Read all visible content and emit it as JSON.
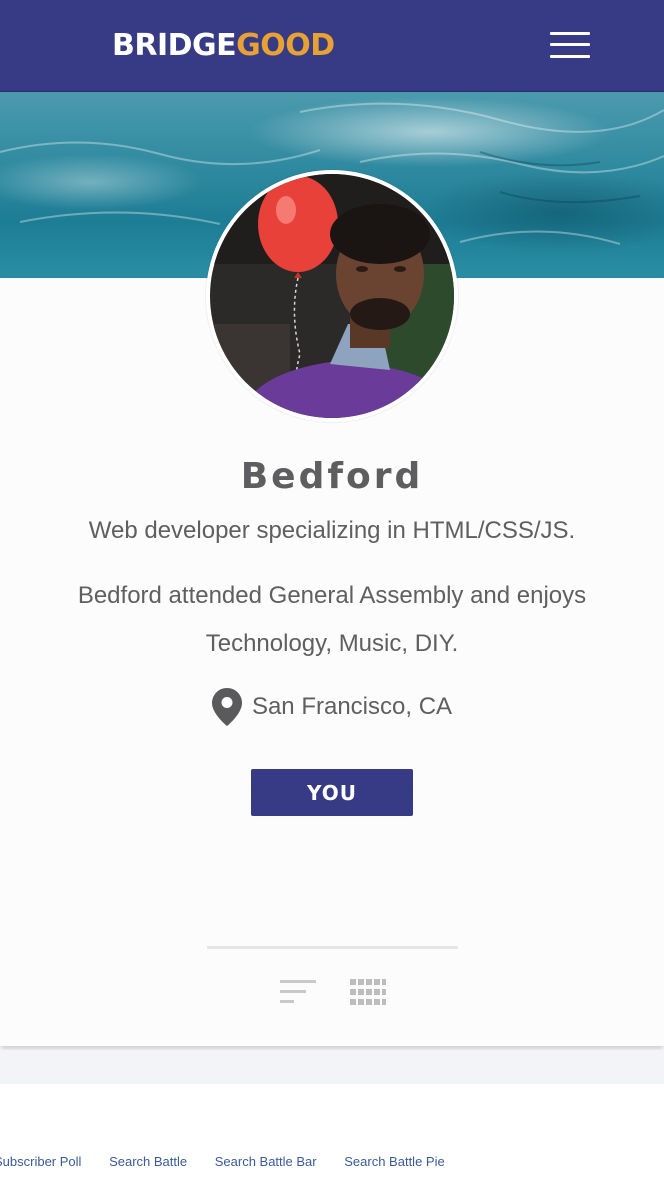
{
  "header": {
    "logo_part1": "BRIDGE",
    "logo_part2": "GOOD",
    "menu_icon": "hamburger-menu-icon",
    "background": "#373a84",
    "logo_accent": "#e8a133"
  },
  "profile": {
    "name": "Bedford",
    "headline": "Web developer specializing in HTML/CSS/JS.",
    "bio": "Bedford attended General Assembly and enjoys Technology, Music, DIY.",
    "location": "San Francisco, CA",
    "location_icon": "map-pin-icon",
    "button_label": "YOU"
  },
  "view_toggle": {
    "icons": [
      "list-view-icon",
      "grid-view-icon"
    ]
  },
  "bottom_links": [
    "Subscriber Poll",
    "Search Battle",
    "Search Battle Bar",
    "Search Battle Pie"
  ]
}
